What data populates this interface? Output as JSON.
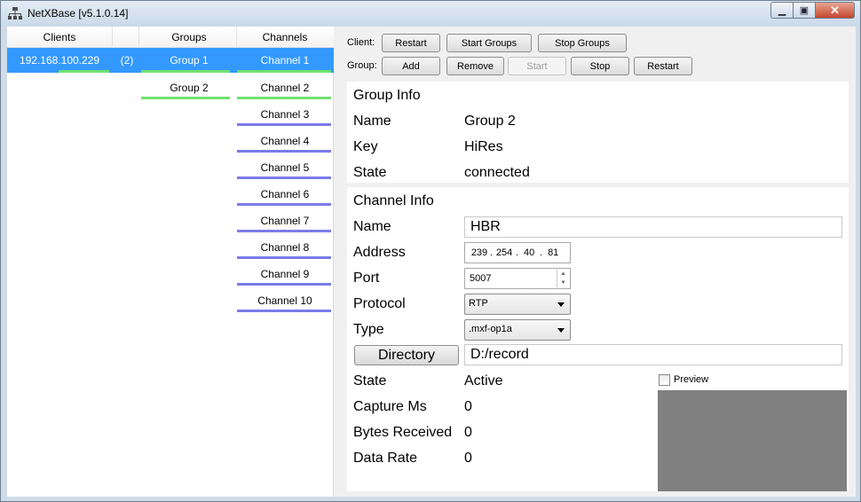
{
  "window": {
    "title": "NetXBase [v5.1.0.14]",
    "icons": {
      "app": "network-icon",
      "minimize": "minimize-icon",
      "maximize": "maximize-icon",
      "close": "close-icon"
    }
  },
  "tree": {
    "columns": [
      "Clients",
      "Groups",
      "Channels"
    ],
    "selected_row": {
      "client": "192.168.100.229",
      "count": "(2)",
      "group": "Group 1",
      "channel": "Channel 1"
    },
    "groups": [
      "Group 1",
      "Group 2"
    ],
    "channels": [
      "Channel 1",
      "Channel 2",
      "Channel 3",
      "Channel 4",
      "Channel 5",
      "Channel 6",
      "Channel 7",
      "Channel 8",
      "Channel 9",
      "Channel 10"
    ],
    "colors": {
      "selection": "#3399ff",
      "active_underline": "#70e070",
      "inactive_underline": "#7b7bea"
    }
  },
  "toolbar": {
    "client_label": "Client:",
    "client_buttons": [
      "Restart",
      "Start Groups",
      "Stop Groups"
    ],
    "group_label": "Group:",
    "group_buttons": [
      "Add",
      "Remove",
      "Start",
      "Stop",
      "Restart"
    ]
  },
  "group_info": {
    "heading": "Group Info",
    "name_label": "Name",
    "name_value": "Group 2",
    "key_label": "Key",
    "key_value": "HiRes",
    "state_label": "State",
    "state_value": "connected"
  },
  "channel_info": {
    "heading": "Channel Info",
    "name_label": "Name",
    "name_value": "HBR",
    "address_label": "Address",
    "address_octets": [
      "239",
      "254",
      "40",
      "81"
    ],
    "port_label": "Port",
    "port_value": "5007",
    "protocol_label": "Protocol",
    "protocol_value": "RTP",
    "type_label": "Type",
    "type_value": ".mxf-op1a",
    "directory_button": "Directory",
    "directory_value": "D:/record",
    "state_label": "State",
    "state_value": "Active",
    "preview_label": "Preview",
    "capture_label": "Capture Ms",
    "capture_value": "0",
    "bytes_label": "Bytes Received",
    "bytes_value": "0",
    "rate_label": "Data Rate",
    "rate_value": "0"
  }
}
